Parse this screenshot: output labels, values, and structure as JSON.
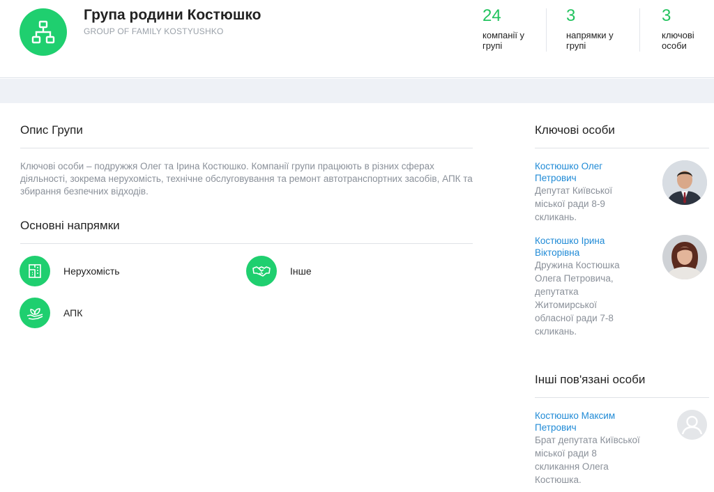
{
  "header": {
    "title": "Група родини Костюшко",
    "subtitle": "GROUP OF FAMILY KOSTYUSHKO",
    "logo_icon": "org-chart-icon",
    "stats": [
      {
        "value": "24",
        "label_line1": "компанії у",
        "label_line2": "групі"
      },
      {
        "value": "3",
        "label_line1": "напрямки у",
        "label_line2": "групі"
      },
      {
        "value": "3",
        "label_line1": "ключові",
        "label_line2": "особи"
      }
    ]
  },
  "description": {
    "title": "Опис Групи",
    "text": "Ключові особи – подружжя Олег та Ірина Костюшко. Компанії групи працюють в різних сферах діяльності, зокрема нерухомість, технічне обслуговування та ремонт автотранспортних засобів, АПК та збирання безпечних відходів."
  },
  "directions": {
    "title": "Основні напрямки",
    "items": [
      {
        "label": "Нерухомість",
        "icon": "building-icon"
      },
      {
        "label": "Інше",
        "icon": "handshake-icon"
      },
      {
        "label": "АПК",
        "icon": "leaf-hand-icon"
      }
    ]
  },
  "key_persons": {
    "title": "Ключові особи",
    "items": [
      {
        "name_line1": "Костюшко Олег",
        "name_line2": "Петрович",
        "desc_lines": [
          "Депутат Київської",
          "міської ради 8-9",
          "скликань."
        ]
      },
      {
        "name_line1": "Костюшко Ірина",
        "name_line2": "Вікторівна",
        "desc_lines": [
          "Дружина Костюшка",
          "Олега Петровича,",
          "депутатка",
          "Житомирської",
          "обласної ради 7-8",
          "скликань."
        ]
      }
    ]
  },
  "other_persons": {
    "title": "Інші пов'язані особи",
    "items": [
      {
        "name_line1": "Костюшко Максим",
        "name_line2": "Петрович",
        "desc_lines": [
          "Брат депутата Київської",
          "міської ради 8",
          "скликання Олега",
          "Костюшка."
        ]
      }
    ]
  },
  "colors": {
    "accent_green": "#1fcf6f",
    "stat_green": "#22c35e",
    "link_blue": "#1f8ad6",
    "muted_text": "#8a9099"
  }
}
